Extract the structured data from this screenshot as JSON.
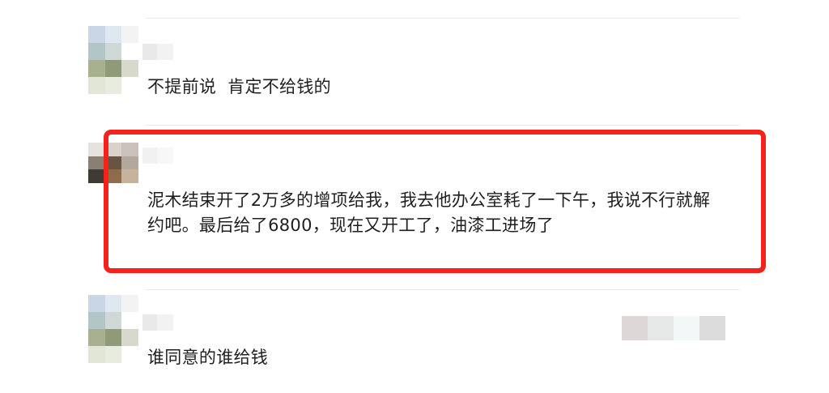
{
  "comments": [
    {
      "text": "不提前说  肯定不给钱的"
    },
    {
      "text": "泥木结束开了2万多的增项给我，我去他办公室耗了一下午，我说不行就解约吧。最后给了6800，现在又开工了，油漆工进场了"
    },
    {
      "text": "谁同意的谁给钱"
    }
  ],
  "colors": {
    "highlight": "#f5211b",
    "divider": "#ececec"
  },
  "icons": {
    "avatar": "pixelated-avatar",
    "username": "blurred-username"
  }
}
